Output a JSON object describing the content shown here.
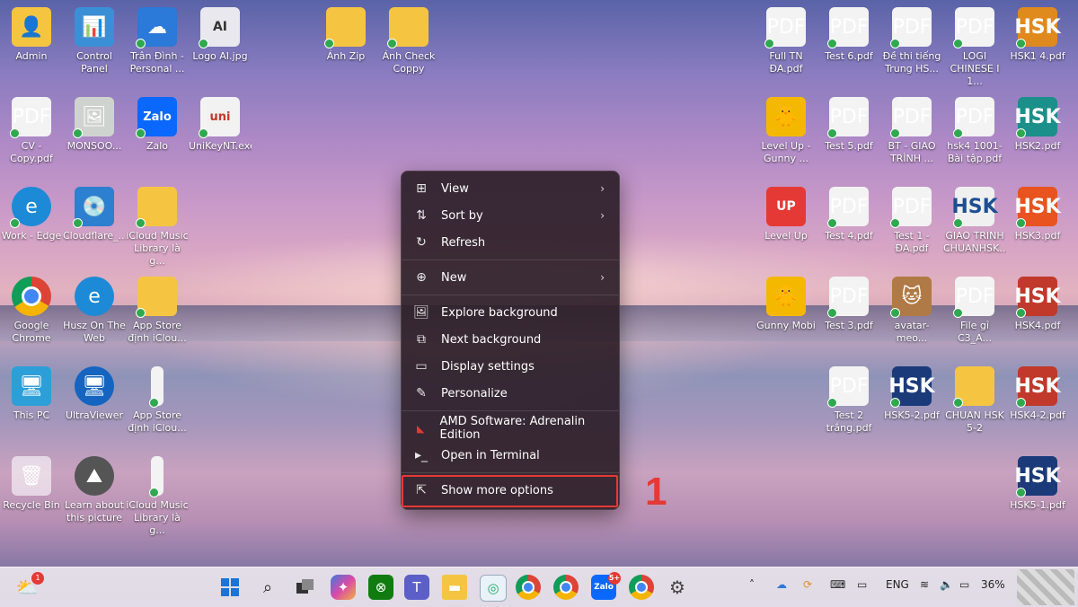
{
  "desktop": {
    "left_icons": [
      {
        "label": "Admin",
        "icon": "user-folder-icon"
      },
      {
        "label": "Control Panel",
        "icon": "control-panel-icon"
      },
      {
        "label": "Trân Đình -\nPersonal ...",
        "icon": "onedrive-icon"
      },
      {
        "label": "Logo AI.jpg",
        "icon": "ai-image-icon"
      },
      {
        "label": "CV -\nCopy.pdf",
        "icon": "pdf-icon"
      },
      {
        "label": "MONSOO...",
        "icon": "image-icon"
      },
      {
        "label": "Zalo",
        "icon": "zalo-icon"
      },
      {
        "label": "UniKeyNT.exe",
        "icon": "unikey-icon"
      },
      {
        "label": "Work - Edge",
        "icon": "edge-icon"
      },
      {
        "label": "Cloudflare_...",
        "icon": "cloudflare-icon"
      },
      {
        "label": "iCloud Music\nLibrary là g...",
        "icon": "folder-icon"
      },
      {
        "label": "Google\nChrome",
        "icon": "chrome-icon"
      },
      {
        "label": "Husz On The\nWeb",
        "icon": "edge-icon"
      },
      {
        "label": "App Store\nđịnh iClou...",
        "icon": "zip-folder-icon"
      },
      {
        "label": "This PC",
        "icon": "monitor-icon"
      },
      {
        "label": "UltraViewer",
        "icon": "ultraviewer-icon"
      },
      {
        "label": "App Store\nđịnh iClou...",
        "icon": "file-icon"
      },
      {
        "label": "Recycle Bin",
        "icon": "recycle-bin-icon"
      },
      {
        "label": "Learn about\nthis picture",
        "icon": "camera-icon"
      },
      {
        "label": "iCloud Music\nLibrary là g...",
        "icon": "file-icon"
      }
    ],
    "top_icons": [
      {
        "label": "Ảnh Zip",
        "icon": "folder-icon"
      },
      {
        "label": "Ảnh Check\nCoppy",
        "icon": "folder-icon"
      }
    ],
    "right_icons": [
      {
        "label": "Full TN\nĐA.pdf",
        "icon": "pdf-icon"
      },
      {
        "label": "Test 6.pdf",
        "icon": "pdf-icon"
      },
      {
        "label": "Đề thi tiếng\nTrung HS...",
        "icon": "pdf-icon"
      },
      {
        "label": "LOGI\nCHINESE I 1...",
        "icon": "pdf-icon"
      },
      {
        "label": "HSK1 4.pdf",
        "icon": "hsk-icon"
      },
      {
        "label": "Level Up -\nGunny ...",
        "icon": "gunny-icon"
      },
      {
        "label": "Test 5.pdf",
        "icon": "pdf-icon"
      },
      {
        "label": "BT - GIAO\nTRÌNH ...",
        "icon": "pdf-icon"
      },
      {
        "label": "hsk4 1001-\nBài tập.pdf",
        "icon": "pdf-icon"
      },
      {
        "label": "HSK2.pdf",
        "icon": "hsk-icon"
      },
      {
        "label": "Level Up",
        "icon": "levelup-icon"
      },
      {
        "label": "Test 4.pdf",
        "icon": "pdf-icon"
      },
      {
        "label": "Test 1 -\nĐA.pdf",
        "icon": "pdf-icon"
      },
      {
        "label": "GIAO TRINH\nCHUANHSK...",
        "icon": "hsk-icon"
      },
      {
        "label": "HSK3.pdf",
        "icon": "hsk-icon"
      },
      {
        "label": "Gunny Mobi",
        "icon": "gunny-icon"
      },
      {
        "label": "Test 3.pdf",
        "icon": "pdf-icon"
      },
      {
        "label": "avatar-meo...",
        "icon": "image-icon"
      },
      {
        "label": "File gỉ C3_A...",
        "icon": "pdf-icon"
      },
      {
        "label": "HSK4.pdf",
        "icon": "hsk-icon"
      },
      {
        "label": "Test 2\ntrắng.pdf",
        "icon": "pdf-icon"
      },
      {
        "label": "HSK5-2.pdf",
        "icon": "hsk-icon"
      },
      {
        "label": "CHUAN HSK\n5-2",
        "icon": "folder-icon"
      },
      {
        "label": "HSK4-2.pdf",
        "icon": "hsk-icon"
      },
      {
        "label": "HSK5-1.pdf",
        "icon": "hsk-icon"
      }
    ]
  },
  "context_menu": {
    "items": [
      {
        "label": "View",
        "icon": "grid-view-icon",
        "submenu": true
      },
      {
        "label": "Sort by",
        "icon": "sort-icon",
        "submenu": true
      },
      {
        "label": "Refresh",
        "icon": "refresh-icon",
        "submenu": false
      },
      {
        "label": "New",
        "icon": "plus-circle-icon",
        "submenu": true
      },
      {
        "label": "Explore background",
        "icon": "image-icon",
        "submenu": false
      },
      {
        "label": "Next background",
        "icon": "next-image-icon",
        "submenu": false
      },
      {
        "label": "Display settings",
        "icon": "display-icon",
        "submenu": false
      },
      {
        "label": "Personalize",
        "icon": "brush-icon",
        "submenu": false
      },
      {
        "label": "AMD Software: Adrenalin Edition",
        "icon": "amd-icon",
        "submenu": false
      },
      {
        "label": "Open in Terminal",
        "icon": "terminal-icon",
        "submenu": false
      },
      {
        "label": "Show more options",
        "icon": "more-options-icon",
        "submenu": false
      }
    ],
    "highlight_step": "1"
  },
  "taskbar": {
    "weather_badge": "1",
    "apps": [
      "windows-start-icon",
      "search-icon",
      "task-view-icon",
      "copilot-icon",
      "xbox-icon",
      "teams-icon",
      "file-explorer-icon",
      "snipping-icon",
      "chrome-icon",
      "chrome-profile-icon",
      "zalo-icon",
      "chrome-profile-icon",
      "settings-icon"
    ],
    "zalo_badge": "5+",
    "language": "ENG",
    "battery": "36%"
  },
  "colors": {
    "highlight": "#e53935",
    "menu_bg": "#2c1e28",
    "taskbar_bg": "#ebe6ee"
  }
}
